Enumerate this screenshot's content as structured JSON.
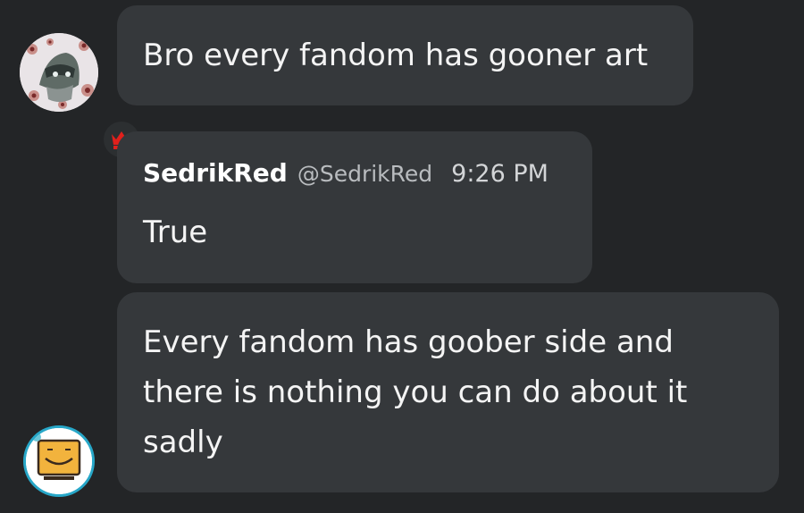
{
  "messages": [
    {
      "text": "Bro every fandom has gooner art"
    },
    {
      "username": "SedrikRed",
      "handle": "@SedrikRed",
      "time": "9:26 PM",
      "text": "True"
    },
    {
      "text": "Every fandom has goober side and there is nothing you can do about it sadly"
    }
  ],
  "colors": {
    "background": "#232527",
    "bubble": "#35383b",
    "crown": "#e0201c",
    "avatar_ring": "#27a7c8"
  },
  "icons": {
    "badge": "crown-icon",
    "avatar1": "user-avatar-icon",
    "avatar3": "user-avatar-icon"
  }
}
